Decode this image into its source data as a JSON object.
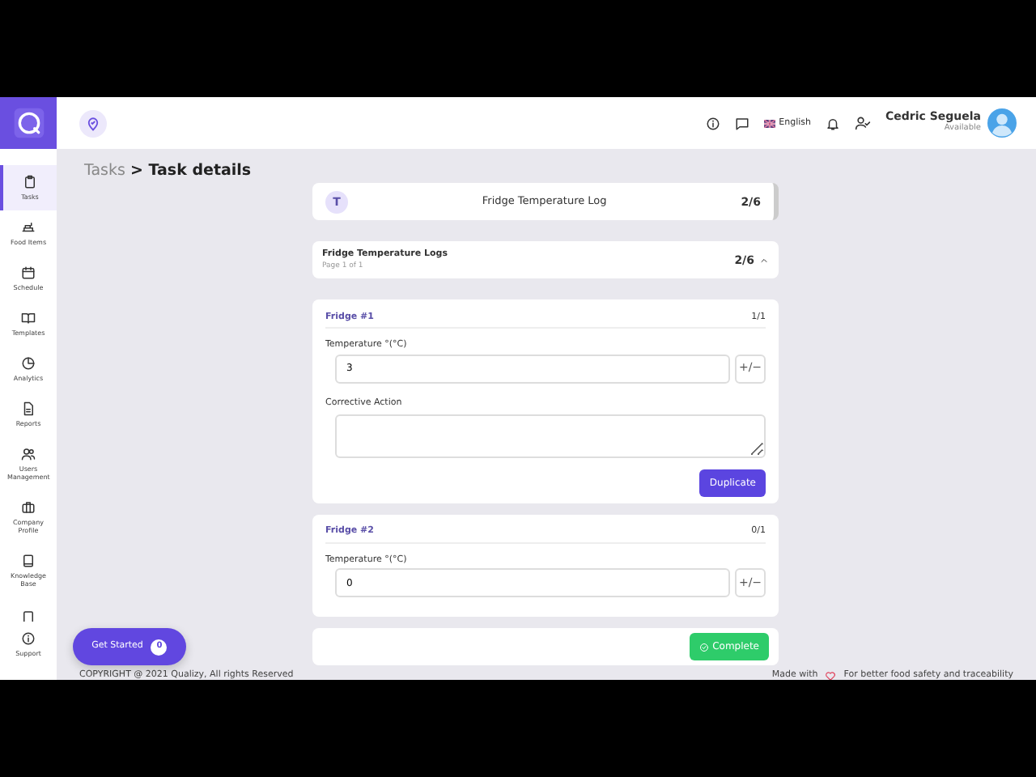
{
  "sidebar": {
    "items": [
      {
        "label": "Tasks",
        "selected": true
      },
      {
        "label": "Food Items",
        "selected": false
      },
      {
        "label": "Schedule",
        "selected": false
      },
      {
        "label": "Templates",
        "selected": false
      },
      {
        "label": "Analytics",
        "selected": false
      },
      {
        "label": "Reports",
        "selected": false
      },
      {
        "label": "Users Management",
        "selected": false
      },
      {
        "label": "Company Profile",
        "selected": false
      },
      {
        "label": "Knowledge Base",
        "selected": false
      },
      {
        "selected": false
      },
      {
        "label": "Support",
        "selected": false
      }
    ]
  },
  "topbar": {
    "language": "English",
    "user_name": "Cedric Seguela",
    "user_status": "Available"
  },
  "breadcrumb": {
    "parent": "Tasks",
    "separator": ">",
    "current": "Task details"
  },
  "task_header": {
    "badge": "T",
    "title": "Fridge Temperature Log",
    "count": "2/6"
  },
  "section": {
    "title": "Fridge Temperature Logs",
    "subtitle": "Page 1 of 1",
    "count": "2/6",
    "expanded": true
  },
  "fridges": [
    {
      "title": "Fridge #1",
      "count": "1/1",
      "fields": [
        {
          "kind": "number",
          "label": "Temperature °(°C)",
          "value": "3",
          "toggle": "+/−"
        },
        {
          "kind": "textarea",
          "label": "Corrective Action"
        }
      ],
      "button": "Duplicate"
    },
    {
      "title": "Fridge #2",
      "count": "0/1",
      "fields": [
        {
          "kind": "number",
          "label": "Temperature °(°C)",
          "value": "0",
          "toggle": "+/−"
        }
      ]
    }
  ],
  "complete_button": "Complete",
  "get_started": {
    "label": "Get Started",
    "count": "0"
  },
  "footer": {
    "copyright": "COPYRIGHT @ 2021 Qualizy, All rights Reserved",
    "made_with": "Made with",
    "tagline": "For better food safety and traceability"
  }
}
